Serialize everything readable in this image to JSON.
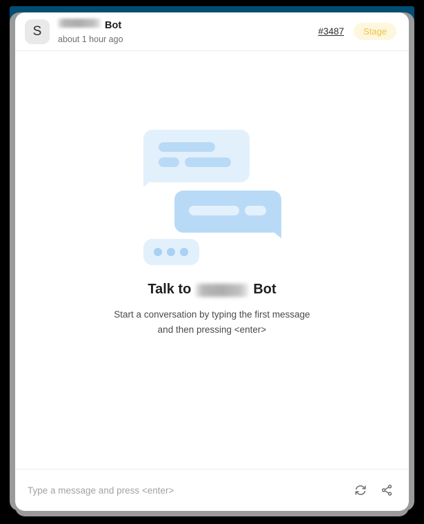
{
  "window": {
    "frame_color": "#000000",
    "top_band_color": "#024e73",
    "card_background": "#ffffff"
  },
  "header": {
    "avatar_initial": "S",
    "name_redacted": true,
    "name_suffix": "Bot",
    "timestamp": "about 1 hour ago",
    "ticket_link": "#3487",
    "status_badge": {
      "label": "Stage",
      "text_color": "#f3bf44",
      "background_color": "#fdf7dd"
    }
  },
  "empty_state": {
    "title_prefix": "Talk to",
    "title_redacted": true,
    "title_suffix": "Bot",
    "subtitle_line_1": "Start a conversation by typing the first message",
    "subtitle_line_2": "and then pressing <enter>",
    "illustration": {
      "bubble_light_color": "#e2f0fc",
      "bubble_medium_color": "#b9daf6",
      "dot_color": "#a8d1f4"
    }
  },
  "composer": {
    "placeholder": "Type a message and press <enter>",
    "value": "",
    "refresh_icon": "refresh-icon",
    "share_icon": "share-icon"
  }
}
